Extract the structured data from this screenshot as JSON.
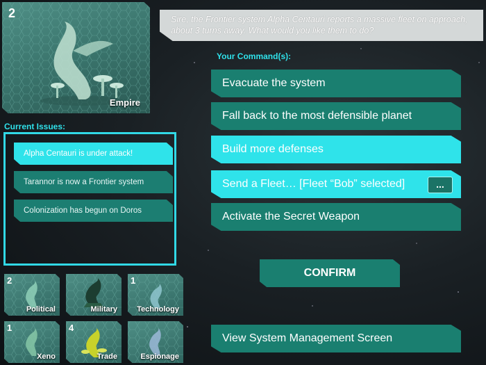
{
  "advisor": {
    "count": "2",
    "label": "Empire"
  },
  "message": "Sire, the Frontier system Alpha Centauri reports a massive fleet on approach, about 3 turns away.  What would you like them to do?",
  "issues": {
    "title": "Current Issues:",
    "items": [
      {
        "label": "Alpha Centauri is under attack!",
        "active": true
      },
      {
        "label": "Tarannor is now a Frontier system",
        "active": false
      },
      {
        "label": "Colonization has begun on Doros",
        "active": false
      }
    ]
  },
  "advisors": [
    {
      "name": "Political",
      "count": "2",
      "color": "#8fd0b8"
    },
    {
      "name": "Military",
      "count": "",
      "color": "#1c3d30"
    },
    {
      "name": "Technology",
      "count": "1",
      "color": "#8fc6cf"
    },
    {
      "name": "Xeno",
      "count": "1",
      "color": "#86c7a7"
    },
    {
      "name": "Trade",
      "count": "4",
      "color": "#c8d22a"
    },
    {
      "name": "Espionage",
      "count": "",
      "color": "#9bb8d8"
    }
  ],
  "commands": {
    "title": "Your Command(s):",
    "items": [
      {
        "label": "Evacuate the system",
        "active": false
      },
      {
        "label": "Fall back to the most defensible planet",
        "active": false
      },
      {
        "label": "Build more defenses",
        "active": true
      },
      {
        "label": "Send a Fleet… [Fleet “Bob” selected]",
        "active": true,
        "more": "..."
      },
      {
        "label": "Activate the Secret Weapon",
        "active": false
      }
    ]
  },
  "confirm_label": "CONFIRM",
  "system_button": "View System Management Screen"
}
